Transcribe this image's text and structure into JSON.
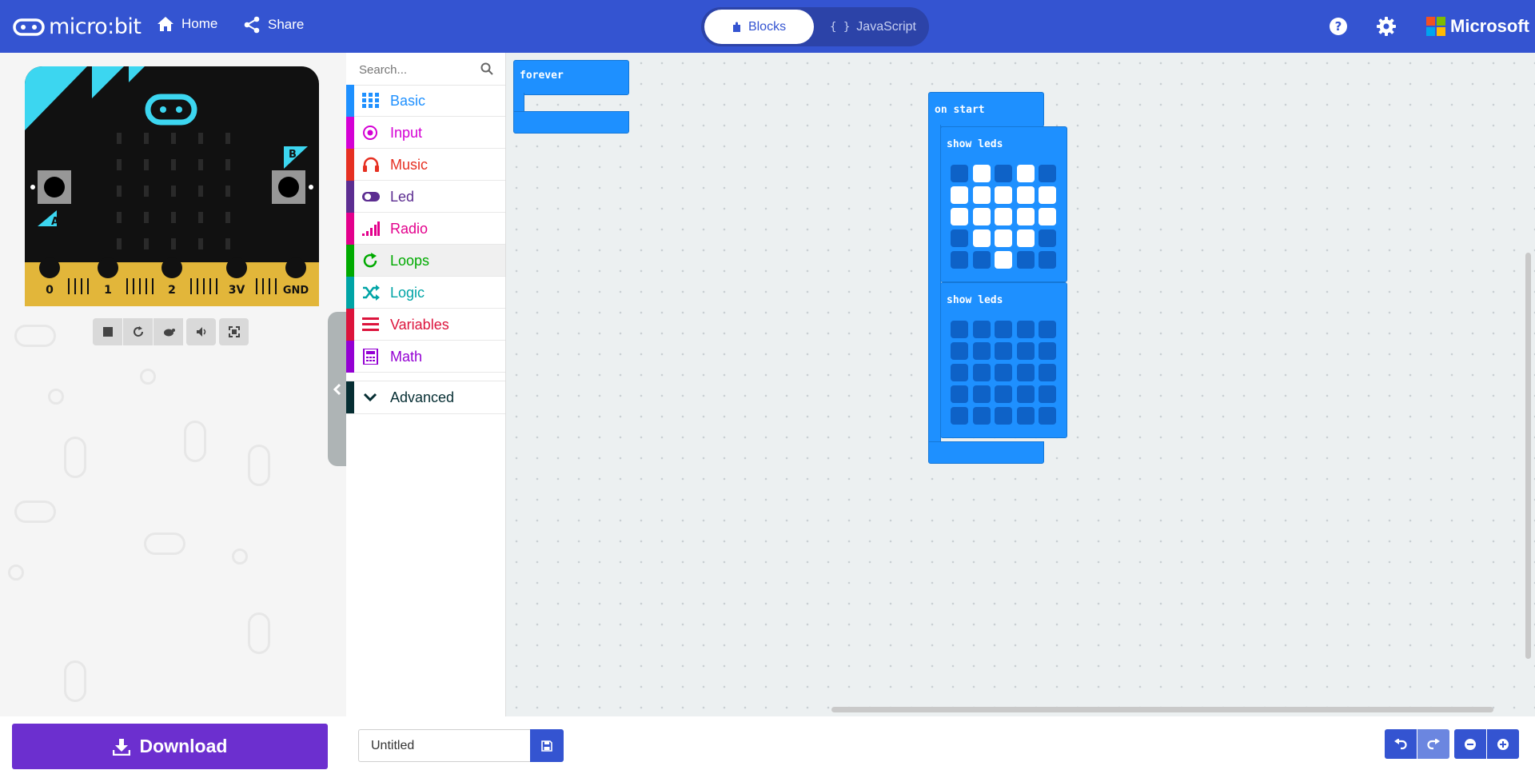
{
  "header": {
    "brand": "micro:bit",
    "home_label": "Home",
    "share_label": "Share",
    "editor_tabs": [
      {
        "label": "Blocks",
        "icon": "puzzle-icon",
        "active": true
      },
      {
        "label": "JavaScript",
        "icon": "braces-icon",
        "active": false
      }
    ],
    "right_icons": [
      "help-icon",
      "settings-icon"
    ],
    "microsoft_label": "Microsoft"
  },
  "simulator": {
    "pins": [
      "0",
      "1",
      "2",
      "3V",
      "GND"
    ],
    "button_a": "A",
    "button_b": "B",
    "controls": [
      "stop-icon",
      "restart-icon",
      "slowmo-icon",
      "mute-icon",
      "fullscreen-icon"
    ]
  },
  "toolbox": {
    "search_placeholder": "Search...",
    "categories": [
      {
        "label": "Basic",
        "color": "#1E90FF",
        "icon": "grid-icon"
      },
      {
        "label": "Input",
        "color": "#D400D4",
        "icon": "target-icon"
      },
      {
        "label": "Music",
        "color": "#E63022",
        "icon": "headphones-icon"
      },
      {
        "label": "Led",
        "color": "#5C2D91",
        "icon": "toggle-icon"
      },
      {
        "label": "Radio",
        "color": "#E3008C",
        "icon": "signal-bars-icon"
      },
      {
        "label": "Loops",
        "color": "#00AA00",
        "icon": "refresh-icon"
      },
      {
        "label": "Logic",
        "color": "#00A4A6",
        "icon": "shuffle-icon"
      },
      {
        "label": "Variables",
        "color": "#DC143C",
        "icon": "list-icon"
      },
      {
        "label": "Math",
        "color": "#9400D3",
        "icon": "calculator-icon"
      }
    ],
    "advanced": {
      "label": "Advanced",
      "color": "#062E33",
      "icon": "chevron-down-icon"
    }
  },
  "workspace": {
    "forever_label": "forever",
    "on_start_label": "on start",
    "show_leds_blocks": [
      {
        "label": "show leds",
        "grid": [
          [
            0,
            1,
            0,
            1,
            0
          ],
          [
            1,
            1,
            1,
            1,
            1
          ],
          [
            1,
            1,
            1,
            1,
            1
          ],
          [
            0,
            1,
            1,
            1,
            0
          ],
          [
            0,
            0,
            1,
            0,
            0
          ]
        ]
      },
      {
        "label": "show leds",
        "grid": [
          [
            0,
            0,
            0,
            0,
            0
          ],
          [
            0,
            0,
            0,
            0,
            0
          ],
          [
            0,
            0,
            0,
            0,
            0
          ],
          [
            0,
            0,
            0,
            0,
            0
          ],
          [
            0,
            0,
            0,
            0,
            0
          ]
        ]
      }
    ]
  },
  "footer": {
    "download_label": "Download",
    "project_name": "Untitled",
    "save_icon": "save-icon",
    "undo_icon": "undo-icon",
    "redo_icon": "redo-icon",
    "zoom_out_icon": "zoom-out-icon",
    "zoom_in_icon": "zoom-in-icon"
  }
}
